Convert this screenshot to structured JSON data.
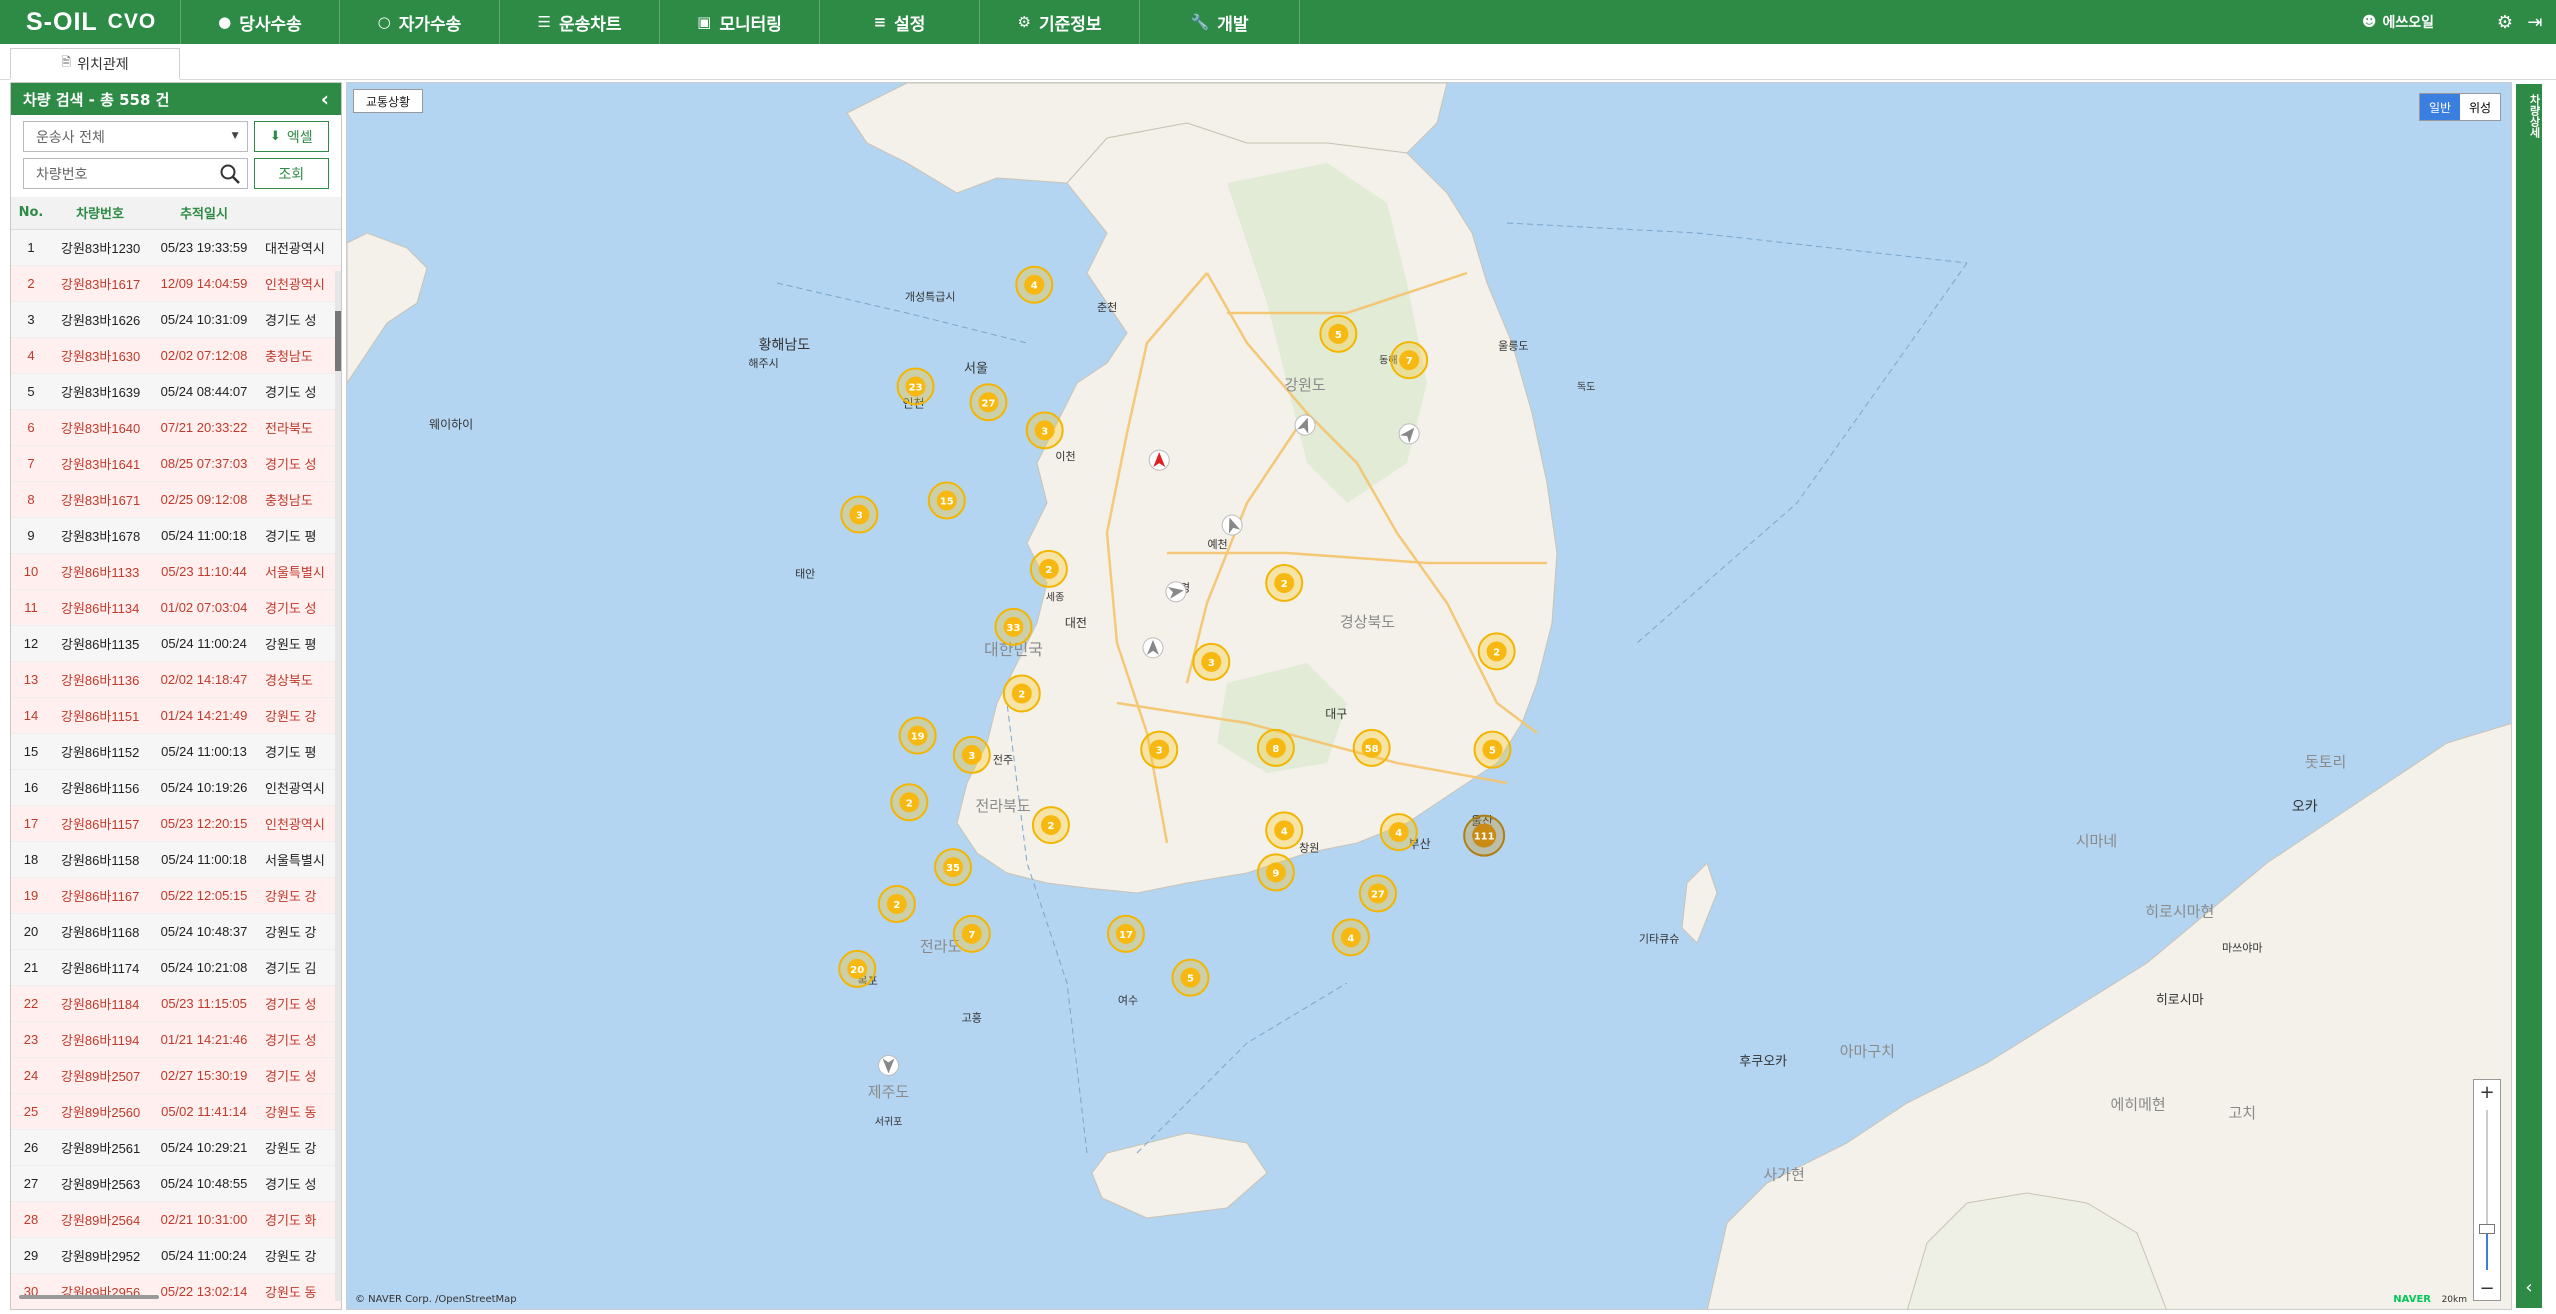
{
  "header": {
    "logo_brand": "S-OIL",
    "logo_product": "CVO",
    "nav": [
      {
        "label": "당사수송",
        "icon": "map-pin-icon"
      },
      {
        "label": "자가수송",
        "icon": "map-pin-icon"
      },
      {
        "label": "운송차트",
        "icon": "sliders-icon"
      },
      {
        "label": "모니터링",
        "icon": "monitor-icon"
      },
      {
        "label": "설정",
        "icon": "list-icon"
      },
      {
        "label": "기준정보",
        "icon": "cogs-icon"
      },
      {
        "label": "개발",
        "icon": "wrench-icon"
      }
    ],
    "user_label": "에쓰오일"
  },
  "tabs": [
    {
      "label": "위치관제"
    }
  ],
  "panel": {
    "title": "차량 검색 - 총 558 건",
    "carrier_select": "운송사 전체",
    "excel_button": "엑셀",
    "vehicle_placeholder": "차량번호",
    "search_button": "조회",
    "columns": [
      "No.",
      "차량번호",
      "추적일시",
      ""
    ],
    "rows": [
      {
        "no": "1",
        "car": "강원83바1230",
        "time": "05/23 19:33:59",
        "loc": "대전광역시",
        "alert": false
      },
      {
        "no": "2",
        "car": "강원83바1617",
        "time": "12/09 14:04:59",
        "loc": "인천광역시",
        "alert": true
      },
      {
        "no": "3",
        "car": "강원83바1626",
        "time": "05/24 10:31:09",
        "loc": "경기도 성",
        "alert": false
      },
      {
        "no": "4",
        "car": "강원83바1630",
        "time": "02/02 07:12:08",
        "loc": "충청남도",
        "alert": true
      },
      {
        "no": "5",
        "car": "강원83바1639",
        "time": "05/24 08:44:07",
        "loc": "경기도 성",
        "alert": false
      },
      {
        "no": "6",
        "car": "강원83바1640",
        "time": "07/21 20:33:22",
        "loc": "전라북도",
        "alert": true
      },
      {
        "no": "7",
        "car": "강원83바1641",
        "time": "08/25 07:37:03",
        "loc": "경기도 성",
        "alert": true
      },
      {
        "no": "8",
        "car": "강원83바1671",
        "time": "02/25 09:12:08",
        "loc": "충청남도",
        "alert": true
      },
      {
        "no": "9",
        "car": "강원83바1678",
        "time": "05/24 11:00:18",
        "loc": "경기도 평",
        "alert": false
      },
      {
        "no": "10",
        "car": "강원86바1133",
        "time": "05/23 11:10:44",
        "loc": "서울특별시",
        "alert": true
      },
      {
        "no": "11",
        "car": "강원86바1134",
        "time": "01/02 07:03:04",
        "loc": "경기도 성",
        "alert": true
      },
      {
        "no": "12",
        "car": "강원86바1135",
        "time": "05/24 11:00:24",
        "loc": "강원도 평",
        "alert": false
      },
      {
        "no": "13",
        "car": "강원86바1136",
        "time": "02/02 14:18:47",
        "loc": "경상북도",
        "alert": true
      },
      {
        "no": "14",
        "car": "강원86바1151",
        "time": "01/24 14:21:49",
        "loc": "강원도 강",
        "alert": true
      },
      {
        "no": "15",
        "car": "강원86바1152",
        "time": "05/24 11:00:13",
        "loc": "경기도 평",
        "alert": false
      },
      {
        "no": "16",
        "car": "강원86바1156",
        "time": "05/24 10:19:26",
        "loc": "인천광역시",
        "alert": false
      },
      {
        "no": "17",
        "car": "강원86바1157",
        "time": "05/23 12:20:15",
        "loc": "인천광역시",
        "alert": true
      },
      {
        "no": "18",
        "car": "강원86바1158",
        "time": "05/24 11:00:18",
        "loc": "서울특별시",
        "alert": false
      },
      {
        "no": "19",
        "car": "강원86바1167",
        "time": "05/22 12:05:15",
        "loc": "강원도 강",
        "alert": true
      },
      {
        "no": "20",
        "car": "강원86바1168",
        "time": "05/24 10:48:37",
        "loc": "강원도 강",
        "alert": false
      },
      {
        "no": "21",
        "car": "강원86바1174",
        "time": "05/24 10:21:08",
        "loc": "경기도 김",
        "alert": false
      },
      {
        "no": "22",
        "car": "강원86바1184",
        "time": "05/23 11:15:05",
        "loc": "경기도 성",
        "alert": true
      },
      {
        "no": "23",
        "car": "강원86바1194",
        "time": "01/21 14:21:46",
        "loc": "경기도 성",
        "alert": true
      },
      {
        "no": "24",
        "car": "강원89바2507",
        "time": "02/27 15:30:19",
        "loc": "경기도 성",
        "alert": true
      },
      {
        "no": "25",
        "car": "강원89바2560",
        "time": "05/02 11:41:14",
        "loc": "강원도 동",
        "alert": true
      },
      {
        "no": "26",
        "car": "강원89바2561",
        "time": "05/24 10:29:21",
        "loc": "강원도 강",
        "alert": false
      },
      {
        "no": "27",
        "car": "강원89바2563",
        "time": "05/24 10:48:55",
        "loc": "경기도 성",
        "alert": false
      },
      {
        "no": "28",
        "car": "강원89바2564",
        "time": "02/21 10:31:00",
        "loc": "경기도 화",
        "alert": true
      },
      {
        "no": "29",
        "car": "강원89바2952",
        "time": "05/24 11:00:24",
        "loc": "강원도 강",
        "alert": false
      },
      {
        "no": "30",
        "car": "강원89바2956",
        "time": "05/22 13:02:14",
        "loc": "강원도 동",
        "alert": true
      }
    ]
  },
  "map": {
    "traffic_button": "교통상황",
    "type_normal": "일반",
    "type_satellite": "위성",
    "zoom_in": "+",
    "zoom_out": "−",
    "copyright_text": "© NAVER Corp. /OpenStreetMap",
    "naver_logo": "NAVER",
    "scale_label": "20km",
    "clusters": [
      {
        "lon": 127.2,
        "lat": 38.05,
        "count": "4"
      },
      {
        "lon": 126.63,
        "lat": 37.47,
        "count": "23"
      },
      {
        "lon": 126.98,
        "lat": 37.38,
        "count": "27"
      },
      {
        "lon": 127.25,
        "lat": 37.22,
        "count": "3"
      },
      {
        "lon": 128.66,
        "lat": 37.77,
        "count": "5"
      },
      {
        "lon": 129.0,
        "lat": 37.62,
        "count": "7"
      },
      {
        "lon": 126.36,
        "lat": 36.74,
        "count": "3"
      },
      {
        "lon": 126.78,
        "lat": 36.82,
        "count": "15"
      },
      {
        "lon": 127.27,
        "lat": 36.43,
        "count": "2"
      },
      {
        "lon": 127.1,
        "lat": 36.1,
        "count": "33"
      },
      {
        "lon": 128.4,
        "lat": 36.35,
        "count": "2"
      },
      {
        "lon": 128.05,
        "lat": 35.9,
        "count": "3"
      },
      {
        "lon": 127.14,
        "lat": 35.72,
        "count": "2"
      },
      {
        "lon": 129.42,
        "lat": 35.96,
        "count": "2"
      },
      {
        "lon": 126.64,
        "lat": 35.48,
        "count": "19"
      },
      {
        "lon": 126.9,
        "lat": 35.37,
        "count": "3"
      },
      {
        "lon": 127.8,
        "lat": 35.4,
        "count": "3"
      },
      {
        "lon": 128.36,
        "lat": 35.41,
        "count": "8"
      },
      {
        "lon": 128.82,
        "lat": 35.41,
        "count": "58"
      },
      {
        "lon": 129.4,
        "lat": 35.4,
        "count": "5"
      },
      {
        "lon": 126.6,
        "lat": 35.1,
        "count": "2"
      },
      {
        "lon": 127.28,
        "lat": 34.97,
        "count": "2"
      },
      {
        "lon": 128.4,
        "lat": 34.94,
        "count": "4"
      },
      {
        "lon": 128.95,
        "lat": 34.93,
        "count": "4"
      },
      {
        "lon": 129.36,
        "lat": 34.91,
        "count": "111"
      },
      {
        "lon": 126.81,
        "lat": 34.73,
        "count": "35"
      },
      {
        "lon": 128.36,
        "lat": 34.7,
        "count": "9"
      },
      {
        "lon": 128.85,
        "lat": 34.58,
        "count": "27"
      },
      {
        "lon": 126.54,
        "lat": 34.52,
        "count": "2"
      },
      {
        "lon": 127.64,
        "lat": 34.35,
        "count": "17"
      },
      {
        "lon": 128.72,
        "lat": 34.33,
        "count": "4"
      },
      {
        "lon": 126.35,
        "lat": 34.15,
        "count": "20"
      },
      {
        "lon": 127.95,
        "lat": 34.1,
        "count": "5"
      },
      {
        "lon": 126.9,
        "lat": 34.35,
        "count": "7"
      }
    ],
    "labels": [
      {
        "lon": 127.1,
        "lat": 35.94,
        "text": "대한민국",
        "size": 16
      },
      {
        "lon": 128.8,
        "lat": 36.1,
        "text": "경상북도",
        "size": 15
      },
      {
        "lon": 128.5,
        "lat": 37.45,
        "text": "강원도",
        "size": 15
      },
      {
        "lon": 127.05,
        "lat": 35.05,
        "text": "전라북도",
        "size": 15
      },
      {
        "lon": 126.75,
        "lat": 34.25,
        "text": "전라도",
        "size": 15
      },
      {
        "lon": 126.5,
        "lat": 33.42,
        "text": "제주도",
        "size": 15
      },
      {
        "lon": 126.0,
        "lat": 37.68,
        "text": "황해남도",
        "size": 14
      },
      {
        "lon": 124.4,
        "lat": 37.23,
        "text": "웨이하이",
        "size": 12
      },
      {
        "lon": 126.92,
        "lat": 37.55,
        "text": "서울",
        "size": 13
      },
      {
        "lon": 126.62,
        "lat": 37.35,
        "text": "인천",
        "size": 12
      },
      {
        "lon": 127.4,
        "lat": 36.1,
        "text": "대전",
        "size": 12
      },
      {
        "lon": 128.65,
        "lat": 35.58,
        "text": "대구",
        "size": 12
      },
      {
        "lon": 129.05,
        "lat": 34.84,
        "text": "부산",
        "size": 12
      },
      {
        "lon": 129.35,
        "lat": 34.97,
        "text": "울산",
        "size": 12
      },
      {
        "lon": 127.65,
        "lat": 33.95,
        "text": "여수",
        "size": 11
      },
      {
        "lon": 128.52,
        "lat": 34.82,
        "text": "창원",
        "size": 11
      },
      {
        "lon": 126.9,
        "lat": 33.85,
        "text": "고흥",
        "size": 11
      },
      {
        "lon": 126.4,
        "lat": 34.06,
        "text": "목포",
        "size": 11
      },
      {
        "lon": 126.5,
        "lat": 33.26,
        "text": "서귀포",
        "size": 10
      },
      {
        "lon": 129.5,
        "lat": 37.68,
        "text": "울릉도",
        "size": 11
      },
      {
        "lon": 129.85,
        "lat": 37.45,
        "text": "독도",
        "size": 10
      },
      {
        "lon": 128.9,
        "lat": 37.6,
        "text": "동해",
        "size": 10
      },
      {
        "lon": 127.55,
        "lat": 37.9,
        "text": "춘천",
        "size": 11
      },
      {
        "lon": 127.3,
        "lat": 36.25,
        "text": "세종",
        "size": 10
      },
      {
        "lon": 127.05,
        "lat": 35.32,
        "text": "전주",
        "size": 11
      },
      {
        "lon": 130.7,
        "lat": 33.6,
        "text": "후쿠오카",
        "size": 13
      },
      {
        "lon": 132.3,
        "lat": 34.85,
        "text": "시마네",
        "size": 15
      },
      {
        "lon": 132.7,
        "lat": 34.45,
        "text": "히로시마현",
        "size": 15
      },
      {
        "lon": 132.7,
        "lat": 33.95,
        "text": "히로시마",
        "size": 13
      },
      {
        "lon": 131.2,
        "lat": 33.65,
        "text": "아마구치",
        "size": 15
      },
      {
        "lon": 132.5,
        "lat": 33.35,
        "text": "에히메현",
        "size": 15
      },
      {
        "lon": 133.4,
        "lat": 35.3,
        "text": "돗토리",
        "size": 15
      },
      {
        "lon": 133.3,
        "lat": 35.05,
        "text": "오카",
        "size": 14
      },
      {
        "lon": 130.8,
        "lat": 32.95,
        "text": "사가현",
        "size": 15
      },
      {
        "lon": 133.0,
        "lat": 33.3,
        "text": "고치",
        "size": 15
      },
      {
        "lon": 130.2,
        "lat": 34.3,
        "text": "기타큐슈",
        "size": 11
      },
      {
        "lon": 133.0,
        "lat": 34.25,
        "text": "마쓰야마",
        "size": 11
      },
      {
        "lon": 125.9,
        "lat": 37.58,
        "text": "해주시",
        "size": 11
      },
      {
        "lon": 126.7,
        "lat": 37.96,
        "text": "개성특급시",
        "size": 11
      },
      {
        "lon": 126.1,
        "lat": 36.38,
        "text": "태안",
        "size": 11
      },
      {
        "lon": 127.35,
        "lat": 37.05,
        "text": "이천",
        "size": 11
      },
      {
        "lon": 128.08,
        "lat": 36.55,
        "text": "예천",
        "size": 11
      },
      {
        "lon": 127.9,
        "lat": 36.3,
        "text": "문경",
        "size": 11
      }
    ],
    "arrows": [
      {
        "lon": 127.8,
        "lat": 37.05,
        "rot": 0,
        "red": true
      },
      {
        "lon": 128.5,
        "lat": 37.25,
        "rot": 20,
        "red": false
      },
      {
        "lon": 129.0,
        "lat": 37.2,
        "rot": 40,
        "red": false
      },
      {
        "lon": 128.15,
        "lat": 36.68,
        "rot": -20,
        "red": false
      },
      {
        "lon": 127.77,
        "lat": 35.98,
        "rot": 0,
        "red": false
      },
      {
        "lon": 127.88,
        "lat": 36.3,
        "rot": 80,
        "red": false
      },
      {
        "lon": 126.5,
        "lat": 33.6,
        "rot": 180,
        "red": false
      }
    ]
  },
  "side_panel": {
    "label": "차량상세"
  }
}
